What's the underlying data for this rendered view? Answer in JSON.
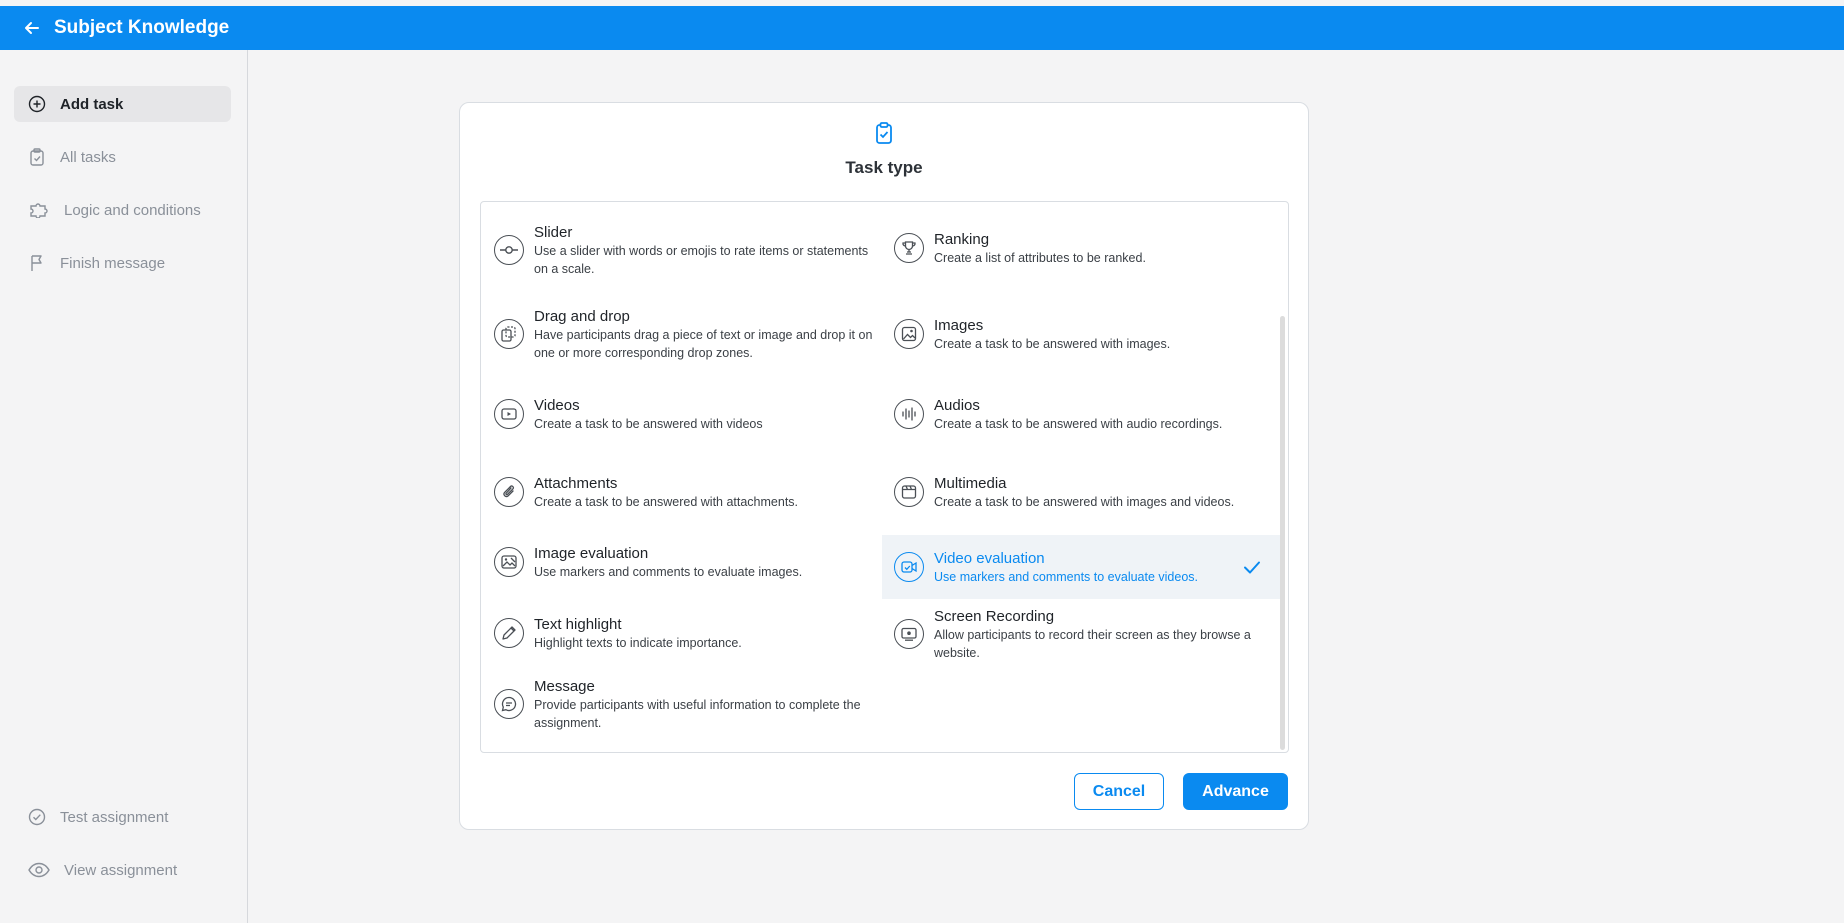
{
  "header": {
    "title": "Subject Knowledge"
  },
  "sidebar": {
    "items": [
      {
        "label": "Add task",
        "icon": "plus-circle-icon"
      },
      {
        "label": "All tasks",
        "icon": "clipboard-icon"
      },
      {
        "label": "Logic and conditions",
        "icon": "puzzle-icon"
      },
      {
        "label": "Finish message",
        "icon": "flag-icon"
      }
    ],
    "bottom": [
      {
        "label": "Test assignment",
        "icon": "check-circle-icon"
      },
      {
        "label": "View assignment",
        "icon": "eye-icon"
      }
    ]
  },
  "modal": {
    "title": "Task type",
    "options_left": [
      {
        "title": "Slider",
        "desc": "Use a slider with words or emojis to rate items or statements on a scale.",
        "icon": "slider-icon"
      },
      {
        "title": "Drag and drop",
        "desc": "Have participants drag a piece of text or image and drop it on one or more corresponding drop zones.",
        "icon": "drag-drop-icon"
      },
      {
        "title": "Videos",
        "desc": "Create a task to be answered with videos",
        "icon": "video-icon"
      },
      {
        "title": "Attachments",
        "desc": "Create a task to be answered with attachments.",
        "icon": "paperclip-icon"
      },
      {
        "title": "Image evaluation",
        "desc": "Use markers and comments to evaluate images.",
        "icon": "image-evaluation-icon"
      },
      {
        "title": "Text highlight",
        "desc": "Highlight texts to indicate importance.",
        "icon": "pencil-icon"
      },
      {
        "title": "Message",
        "desc": "Provide participants with useful information to complete the assignment.",
        "icon": "message-icon"
      }
    ],
    "options_right": [
      {
        "title": "Ranking",
        "desc": "Create a list of attributes to be ranked.",
        "icon": "trophy-icon"
      },
      {
        "title": "Images",
        "desc": "Create a task to be answered with images.",
        "icon": "image-icon"
      },
      {
        "title": "Audios",
        "desc": "Create a task to be answered with audio recordings.",
        "icon": "audio-wave-icon"
      },
      {
        "title": "Multimedia",
        "desc": "Create a task to be answered with images and videos.",
        "icon": "multimedia-icon"
      },
      {
        "title": "Video evaluation",
        "desc": "Use markers and comments to evaluate videos.",
        "icon": "video-evaluation-icon",
        "selected": true
      },
      {
        "title": "Screen Recording",
        "desc": "Allow participants to record their screen as they browse a website.",
        "icon": "screen-record-icon"
      }
    ],
    "cancel_label": "Cancel",
    "advance_label": "Advance"
  },
  "colors": {
    "accent": "#0a8af0",
    "background": "#f4f4f5",
    "selected_row": "#eff3f7"
  }
}
